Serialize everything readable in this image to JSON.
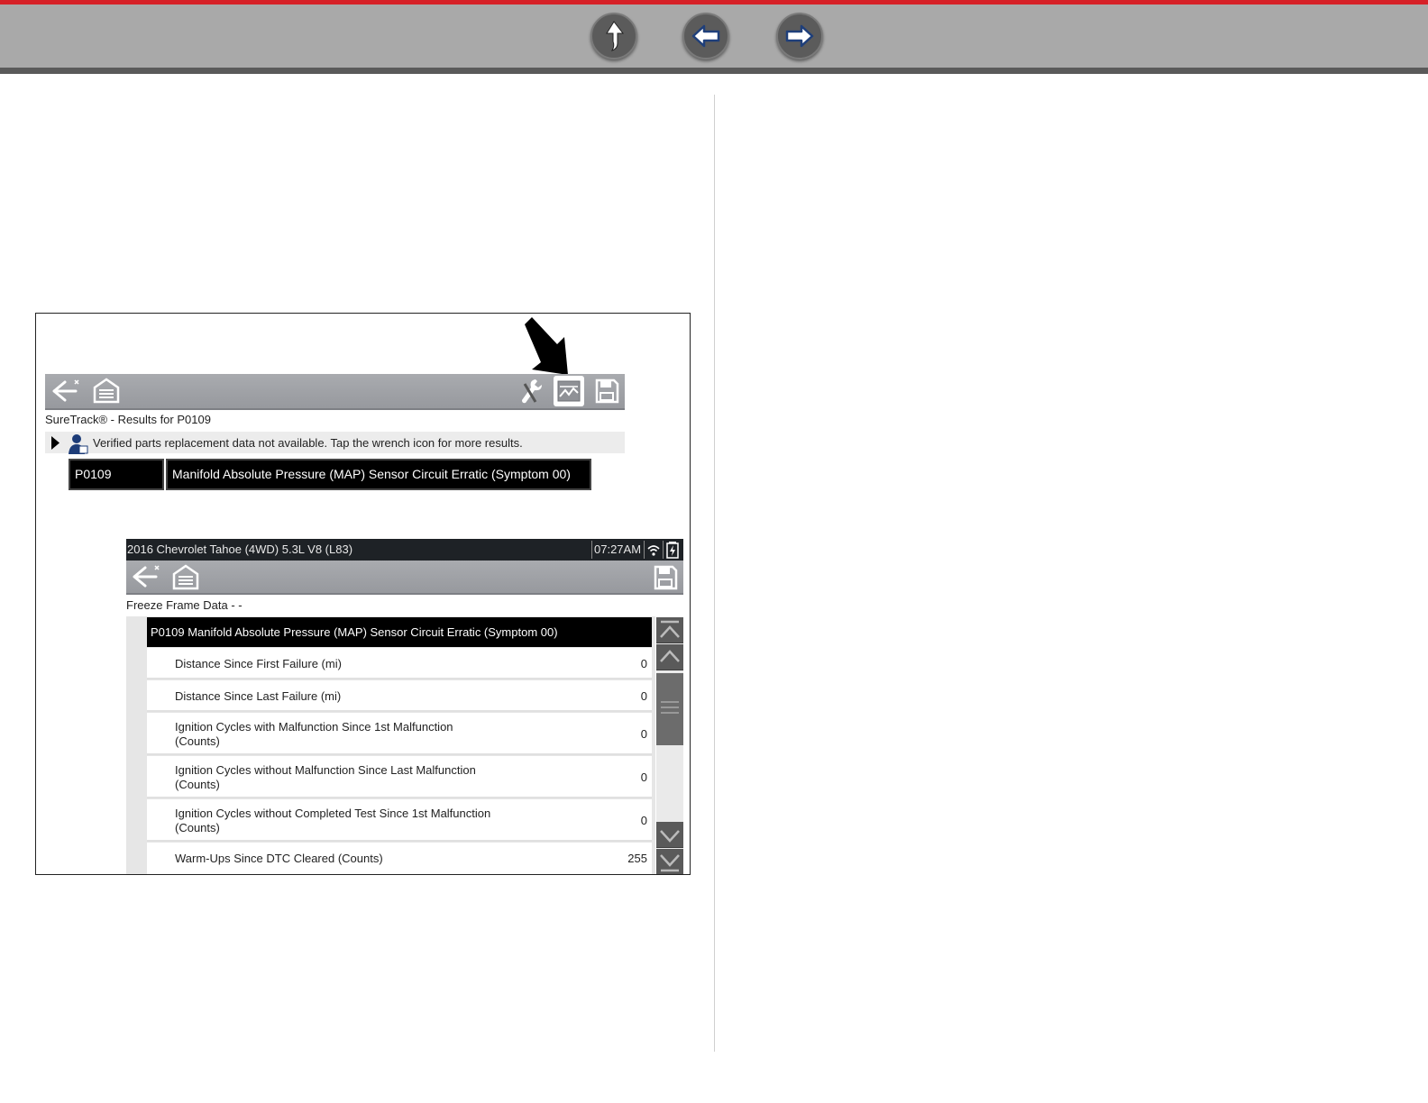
{
  "top_nav": {
    "buttons": [
      "up-arrow-icon",
      "back-arrow-icon",
      "forward-arrow-icon"
    ],
    "accent_color": "#d62027",
    "bar_color": "#a9a9a9"
  },
  "screen1": {
    "toolbar_icons": [
      "back-icon",
      "home-garage-icon",
      "wrench-icon",
      "freeze-frame-icon",
      "save-icon"
    ],
    "title": "SureTrack® - Results for P0109",
    "message": "Verified parts replacement data not available. Tap the wrench icon for more results.",
    "code": "P0109",
    "description": "Manifold Absolute Pressure (MAP) Sensor Circuit Erratic (Symptom 00)"
  },
  "screen2": {
    "vehicle": "2016 Chevrolet Tahoe (4WD) 5.3L V8 (L83)",
    "time": "07:27AM",
    "status_icons": [
      "wifi-icon",
      "battery-icon"
    ],
    "toolbar_icons": [
      "back-icon",
      "home-garage-icon",
      "save-icon"
    ],
    "title": "Freeze Frame Data - -",
    "header": "P0109 Manifold Absolute Pressure (MAP) Sensor Circuit Erratic (Symptom 00)",
    "rows": [
      {
        "label": "Distance Since First Failure (mi)",
        "value": "0"
      },
      {
        "label": "Distance Since Last Failure (mi)",
        "value": "0"
      },
      {
        "label_line1": "Ignition Cycles with Malfunction Since 1st Malfunction",
        "label_line2": "(Counts)",
        "value": "0"
      },
      {
        "label_line1": "Ignition Cycles without Malfunction Since Last Malfunction",
        "label_line2": "(Counts)",
        "value": "0"
      },
      {
        "label_line1": "Ignition Cycles without Completed Test Since 1st Malfunction",
        "label_line2": "(Counts)",
        "value": "0"
      },
      {
        "label": "Warm-Ups Since DTC Cleared (Counts)",
        "value": "255"
      }
    ]
  }
}
